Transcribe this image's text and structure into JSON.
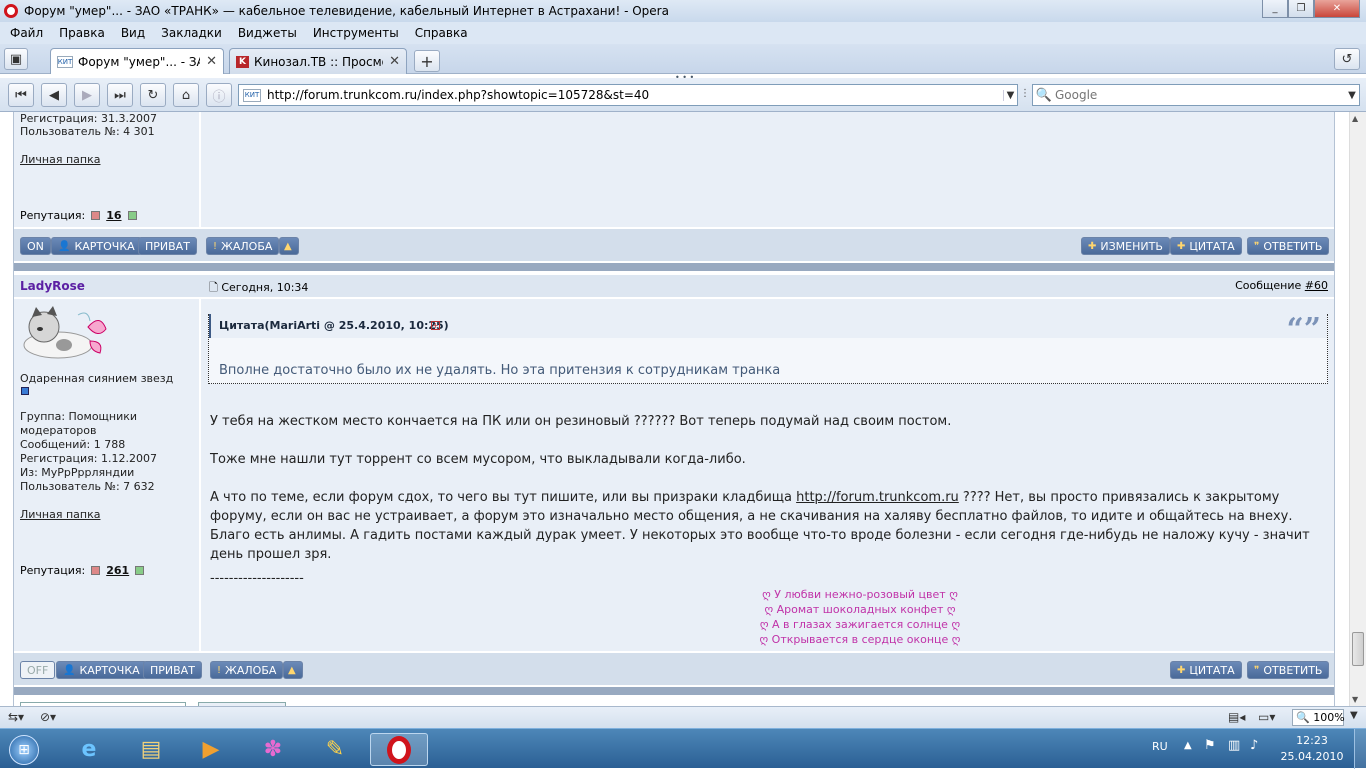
{
  "window": {
    "title": "Форум \"умер\"... - ЗАО «ТРАНК» — кабельное телевидение, кабельный Интернет в Астрахани! - Opera"
  },
  "menu": [
    "Файл",
    "Правка",
    "Вид",
    "Закладки",
    "Виджеты",
    "Инструменты",
    "Справка"
  ],
  "tabs": [
    {
      "label": "Форум \"умер\"... - ЗА...",
      "favicon": "КИТ"
    },
    {
      "label": "Кинозал.ТВ :: Просмо...",
      "favicon": "K"
    }
  ],
  "address": {
    "url": "http://forum.trunkcom.ru/index.php?showtopic=105728&st=40",
    "favicon": "КИТ"
  },
  "search": {
    "placeholder": "Google"
  },
  "prev_post": {
    "registration": "Регистрация: 31.3.2007",
    "user_no": "Пользователь №: 4 301",
    "folder": "Личная папка",
    "rep_label": "Репутация:",
    "rep_value": "16",
    "buttons_left": [
      "ON",
      "КАРТОЧКА",
      "ПРИВАТ"
    ],
    "buttons_mid": [
      "ЖАЛОБА"
    ],
    "buttons_right": [
      "ИЗМЕНИТЬ",
      "ЦИТАТА",
      "ОТВЕТИТЬ"
    ]
  },
  "post": {
    "author": "LadyRose",
    "date": "Сегодня, 10:34",
    "msg_label": "Сообщение",
    "msg_no": "#60",
    "user_title": "Одаренная сиянием звезд",
    "group": "Группа: Помощники модераторов",
    "messages": "Сообщений: 1 788",
    "registration": "Регистрация: 1.12.2007",
    "from": "Из: МуРрРррляндии",
    "user_no": "Пользователь №: 7 632",
    "folder": "Личная папка",
    "rep_label": "Репутация:",
    "rep_value": "261",
    "quote_header": "Цитата(MariArti @ 25.4.2010, 10:25)",
    "quote_text": "Вполне достаточно было их не удалять. Но эта притензия к сотрудникам транка",
    "p1": "У тебя на жестком место кончается на ПК или он резиновый ?????? Вот теперь подумай над своим постом.",
    "p2": "Тоже мне нашли тут торрент со всем мусором, что выкладывали когда-либо.",
    "p3a": "А что по теме, если форум сдох, то чего вы тут пишите, или вы призраки кладбища ",
    "p3link": "http://forum.trunkcom.ru",
    "p3b": " ???? Нет, вы просто привязались к закрытому форуму, если он вас не устраивает, а форум это изначально место общения, а не скачивания на халяву бесплатно файлов, то идите и общайтесь на внеху. Благо есть анлимы. А гадить постами каждый дурак умеет. У некоторых это вообще что-то вроде болезни - если сегодня где-нибудь не наложу кучу - значит день прошел зря.",
    "sig_line": "--------------------",
    "poem": [
      "ღ У любви нежно-розовый цвет ღ",
      "ღ Аромат шоколадных конфет ღ",
      "ღ А в глазах зажигается солнце ღ",
      "ღ Открывается в сердце оконце ღ"
    ],
    "buttons_left": [
      "OFF",
      "КАРТОЧКА",
      "ПРИВАТ"
    ],
    "buttons_mid": [
      "ЖАЛОБА"
    ],
    "buttons_right": [
      "ЦИТАТА",
      "ОТВЕТИТЬ"
    ]
  },
  "status": {
    "zoom": "100%"
  },
  "tray": {
    "lang": "RU",
    "time": "12:23",
    "date": "25.04.2010"
  },
  "colors": {
    "author": "#5b1fa3",
    "poem": "#c032a8",
    "button": "#4a6a99"
  }
}
